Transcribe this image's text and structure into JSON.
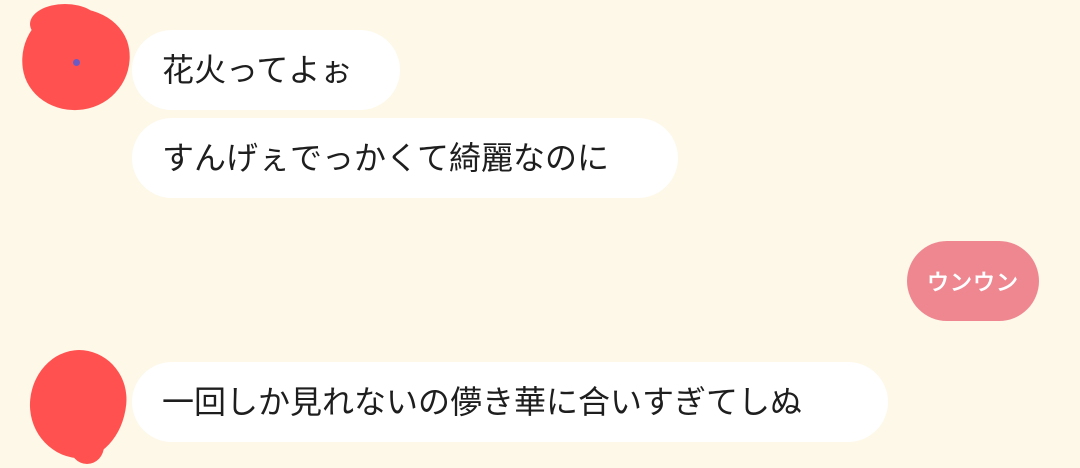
{
  "messages": [
    {
      "sender": "other",
      "text": "花火ってよぉ"
    },
    {
      "sender": "other",
      "text": "すんげぇでっかくて綺麗なのに"
    },
    {
      "sender": "me",
      "text": "ウンウン"
    },
    {
      "sender": "other",
      "text": "一回しか見れないの儚き華に合いすぎてしぬ"
    }
  ],
  "colors": {
    "background": "#fdf8e8",
    "other_bubble": "#ffffff",
    "my_bubble": "#ef8791",
    "avatar_redaction": "#ff5250"
  }
}
